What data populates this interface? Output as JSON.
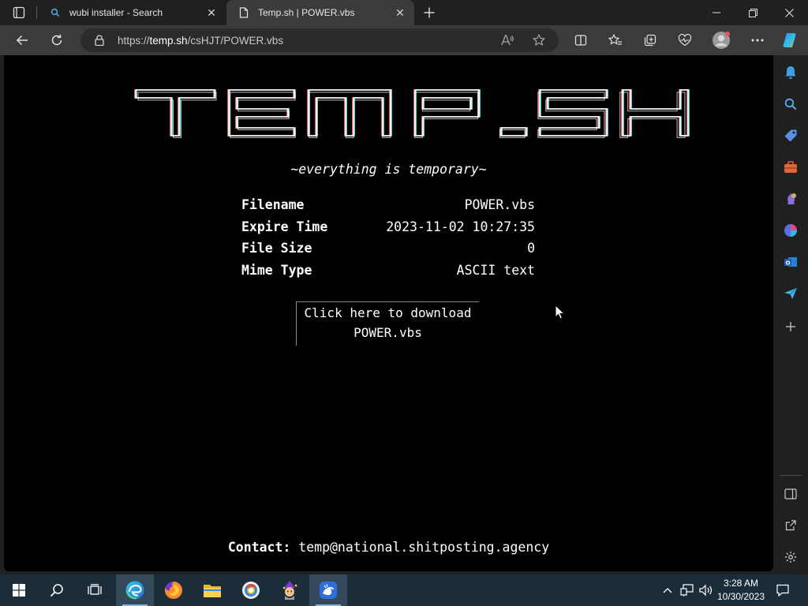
{
  "browser": {
    "tabs": [
      {
        "title": "wubi installer - Search",
        "icon": "search-icon",
        "active": false
      },
      {
        "title": "Temp.sh | POWER.vbs",
        "icon": "document-icon",
        "active": true
      }
    ],
    "address": {
      "scheme": "https://",
      "host": "temp.sh",
      "path": "/csHJT/POWER.vbs"
    }
  },
  "page": {
    "logo_text": "TEMP.SH",
    "tagline": "~everything is temporary~",
    "file_info": [
      {
        "key": "Filename",
        "value": "POWER.vbs"
      },
      {
        "key": "Expire Time",
        "value": "2023-11-02 10:27:35"
      },
      {
        "key": "File Size",
        "value": "0"
      },
      {
        "key": "Mime Type",
        "value": "ASCII text"
      }
    ],
    "download_line1": "Click here to download",
    "download_line2": "POWER.vbs",
    "contact_label": "Contact:",
    "contact_email": "temp@national.shitposting.agency"
  },
  "taskbar": {
    "time": "3:28 AM",
    "date": "10/30/2023"
  },
  "colors": {
    "page_bg": "#000000",
    "page_text": "#ffffff",
    "chrome_bg": "#202020",
    "toolbar_bg": "#3b3b3b",
    "taskbar_bg": "#1c2d3a",
    "edge_accent": "#2aa7e0"
  }
}
